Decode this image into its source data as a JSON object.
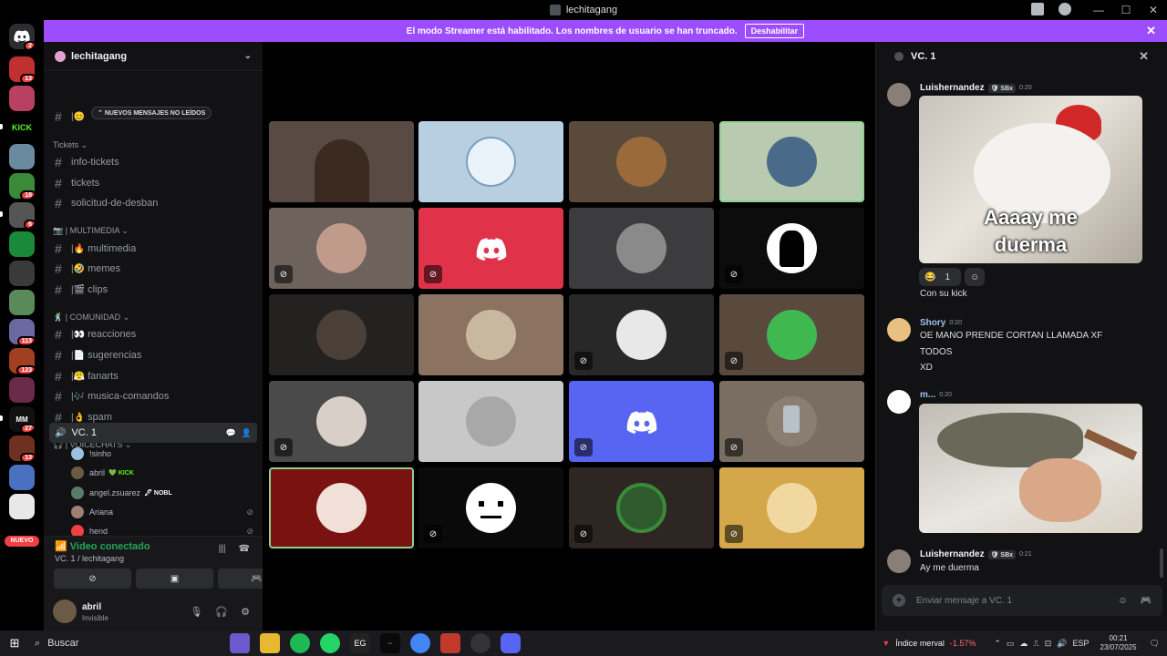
{
  "window": {
    "title": "lechitagang"
  },
  "banner": {
    "text": "El modo Streamer está habilitado. Los nombres de usuario se han truncado.",
    "button": "Deshabilitar"
  },
  "guilds": {
    "badges": [
      "2",
      "13",
      "18",
      "6",
      "113",
      "123",
      "27",
      "13"
    ],
    "nuevo": "NUEVO",
    "kick_label": "KICK"
  },
  "server": {
    "name": "lechitagang"
  },
  "sidebar": {
    "unread_pill": "NUEVOS MENSAJES NO LEÍDOS",
    "cat_tickets": "Tickets",
    "cat_multimedia": "| MULTIMEDIA",
    "cat_comunidad": "| COMUNIDAD",
    "cat_voicechats": "| VOICECHATS",
    "channels": {
      "info_tickets": "info-tickets",
      "tickets": "tickets",
      "solicitud": "solicitud-de-desban",
      "multimedia": "multimedia",
      "memes": "memes",
      "clips": "clips",
      "reacciones": "reacciones",
      "sugerencias": "sugerencias",
      "fanarts": "fanarts",
      "musica": "musica-comandos",
      "spam": "spam"
    },
    "voice_channel": "VC. 1",
    "voice_users": [
      {
        "name": "!sinho",
        "tag": ""
      },
      {
        "name": "abril",
        "tag": "KICK"
      },
      {
        "name": "angel.zsuarez",
        "tag": "NOBL"
      },
      {
        "name": "Ariana",
        "tag": ""
      },
      {
        "name": "hend",
        "tag": ""
      }
    ]
  },
  "voice_panel": {
    "status": "Video conectado",
    "subtitle": "VC. 1 / lechitagang",
    "user_name": "abril",
    "user_status": "Invisible"
  },
  "chat": {
    "header": "VC. 1",
    "messages": [
      {
        "name": "Luishernandez",
        "tag": "SBx",
        "time": "0:20",
        "gif_caption_1": "Aaaay me",
        "gif_caption_2": "duerma",
        "reaction_count": "1",
        "text": "Con su kick"
      },
      {
        "name": "Shory",
        "time": "0:20",
        "line1": "OE MANO PRENDE CORTAN LLAMADA XF",
        "line2": "TODOS",
        "line3": "XD"
      },
      {
        "name": "m...",
        "time": "0:20"
      },
      {
        "name": "Luishernandez",
        "tag": "SBx",
        "time": "0:21",
        "text": "Ay me duerma"
      }
    ],
    "input_placeholder": "Enviar mensaje a VC. 1"
  },
  "taskbar": {
    "search": "Buscar",
    "ticker_name": "Índice merval",
    "ticker_change": "-1.57%",
    "lang": "ESP",
    "time": "00:21",
    "date": "23/07/2025"
  },
  "colors": {
    "accent": "#9b4dff",
    "discord_blurple": "#5865f2",
    "speaking": "#8fd18f",
    "connected": "#23a55a"
  }
}
